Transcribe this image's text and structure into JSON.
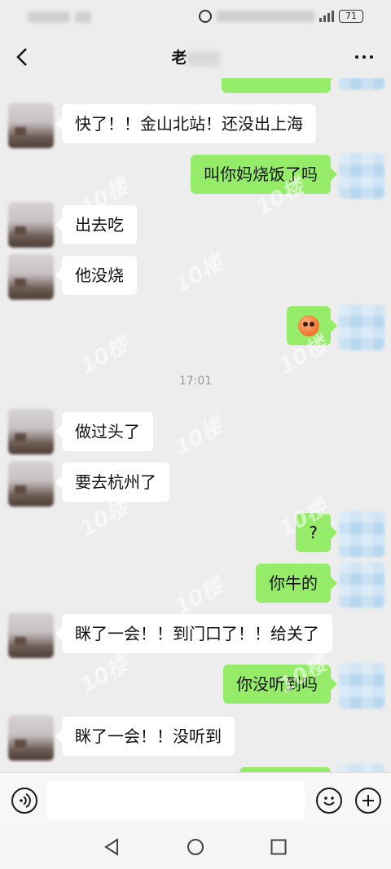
{
  "status_bar": {
    "battery": "71"
  },
  "header": {
    "title": "老",
    "back_icon": "chevron-left-icon",
    "more_icon": "more-dots-icon"
  },
  "messages": [
    {
      "side": "in",
      "text": "快了！！金山北站！还没出上海"
    },
    {
      "side": "out",
      "text": "叫你妈烧饭了吗"
    },
    {
      "side": "in",
      "text": "出去吃"
    },
    {
      "side": "in",
      "text": "他没烧"
    },
    {
      "side": "out",
      "text": "",
      "sticker": "orange-face-emoji"
    },
    {
      "side": "in",
      "text": "做过头了"
    },
    {
      "side": "in",
      "text": "要去杭州了"
    },
    {
      "side": "out",
      "text": "?"
    },
    {
      "side": "out",
      "text": "你牛的"
    },
    {
      "side": "in",
      "text": "眯了一会！！到门口了！！给关了"
    },
    {
      "side": "out",
      "text": "你没听到吗"
    },
    {
      "side": "in",
      "text": "眯了一会！！没听到"
    }
  ],
  "timestamp": "17:01",
  "watermark": "10楼",
  "input_bar": {
    "voice_icon": "voice-icon",
    "emoji_icon": "smiley-icon",
    "plus_icon": "plus-icon",
    "text_value": ""
  },
  "system_nav": {
    "back_icon": "triangle-back-icon",
    "home_icon": "circle-home-icon",
    "recents_icon": "square-recents-icon"
  },
  "colors": {
    "background": "#ededed",
    "outgoing_bubble": "#95ec69",
    "incoming_bubble": "#ffffff"
  }
}
